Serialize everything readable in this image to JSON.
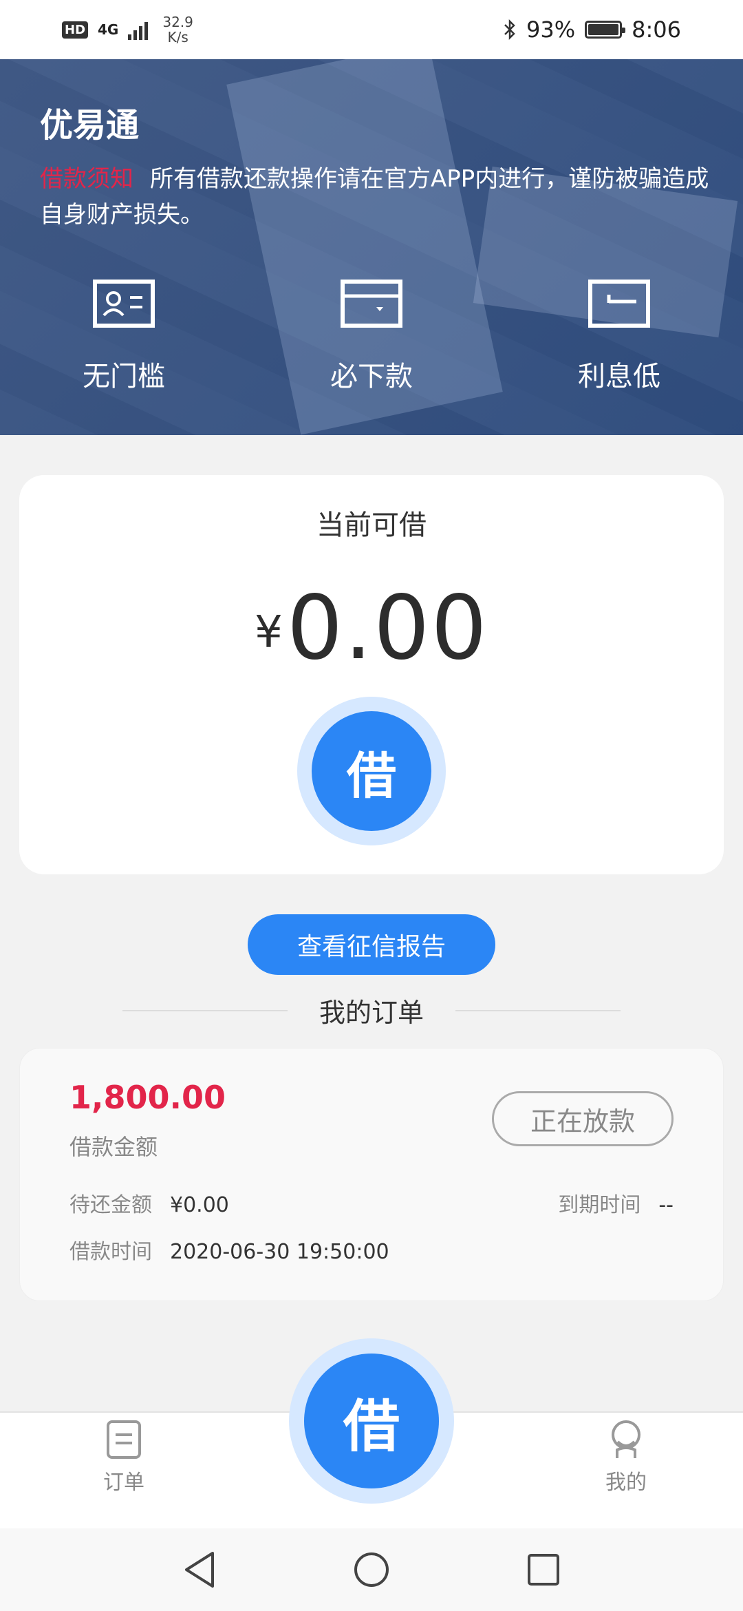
{
  "status_bar": {
    "hd": "HD",
    "network": "4G",
    "speed_value": "32.9",
    "speed_unit": "K/s",
    "battery": "93%",
    "time": "8:06"
  },
  "banner": {
    "app_title": "优易通",
    "notice_tag": "借款须知",
    "notice_text": "所有借款还款操作请在官方APP内进行，谨防被骗造成自身财产损失。",
    "features": [
      {
        "label": "无门槛",
        "icon": "id-card-icon"
      },
      {
        "label": "必下款",
        "icon": "wallet-icon"
      },
      {
        "label": "利息低",
        "icon": "return-arrow-icon"
      }
    ]
  },
  "loan_card": {
    "title": "当前可借",
    "currency": "¥",
    "amount": "0.00",
    "borrow_label": "借"
  },
  "credit_report_button": "查看征信报告",
  "orders_heading": "我的订单",
  "order": {
    "amount": "1,800.00",
    "amount_label": "借款金额",
    "status": "正在放款",
    "pending_label": "待还金额",
    "pending_value": "¥0.00",
    "due_label": "到期时间",
    "due_value": "--",
    "borrow_time_label": "借款时间",
    "borrow_time_value": "2020-06-30 19:50:00"
  },
  "tab_bar": {
    "orders": "订单",
    "borrow": "借",
    "mine": "我的"
  },
  "colors": {
    "accent_blue": "#2b86f5",
    "accent_red": "#e2254a"
  }
}
